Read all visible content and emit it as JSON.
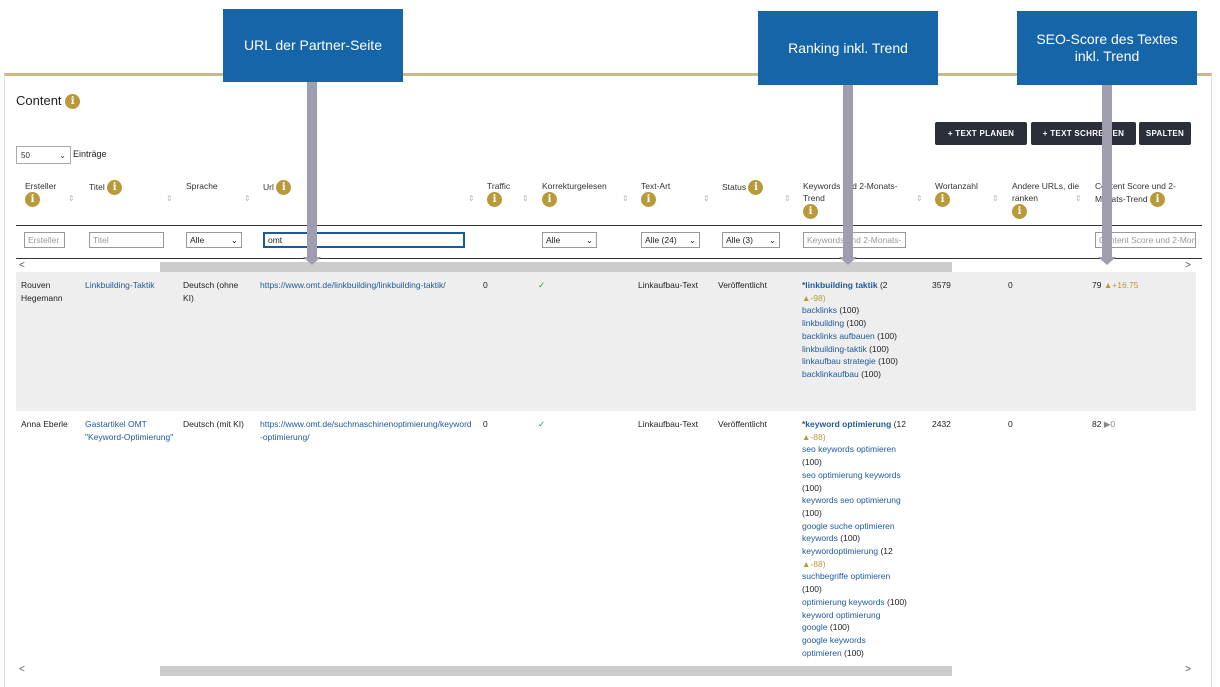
{
  "callouts": {
    "url": "URL der Partner-Seite",
    "ranking": "Ranking inkl. Trend",
    "seo": "SEO-Score des Textes inkl. Trend"
  },
  "content": {
    "title": "Content",
    "info": "i"
  },
  "buttons": {
    "plan": "+ TEXT PLANEN",
    "write": "+ TEXT SCHREIBEN",
    "columns": "SPALTEN"
  },
  "entries": {
    "count": "50",
    "label": "Einträge"
  },
  "headers": {
    "creator": "Ersteller",
    "title": "Titel",
    "language": "Sprache",
    "url": "Url",
    "traffic": "Traffic",
    "proofread": "Korrekturgelesen",
    "type": "Text-Art",
    "status": "Status",
    "keywords": "Keywords und 2-Monats-Trend",
    "words": "Wortanzahl",
    "other": "Andere URLs, die ranken",
    "score": "Content Score und 2-Monats-Trend"
  },
  "filters": {
    "creator": "Ersteller",
    "title": "Titel",
    "language": "Alle",
    "url": "omt",
    "proofread": "Alle",
    "type": "Alle (24)",
    "status": "Alle (3)",
    "keywords": "Keywords und 2-Monats-",
    "score": "Content Score und 2-Mon"
  },
  "rows": [
    {
      "creator": "Rouven Hegemann",
      "title": "Linkbuilding-Taktik",
      "language": "Deutsch (ohne KI)",
      "url": "https://www.omt.de/linkbuilding/linkbuilding-taktik/",
      "traffic": "0",
      "proofread": "✓",
      "type": "Linkaufbau-Text",
      "status": "Veröffentlicht",
      "main_kw": "*linkbuilding taktik",
      "main_rank": "(2",
      "main_trend": "▲-98)",
      "keywords": [
        {
          "k": "backlinks",
          "r": "(100)"
        },
        {
          "k": "linkbuilding",
          "r": "(100)"
        },
        {
          "k": "backlinks aufbauen",
          "r": "(100)"
        },
        {
          "k": "linkbuilding-taktik",
          "r": "(100)"
        },
        {
          "k": "linkaufbau strategie",
          "r": "(100)"
        },
        {
          "k": "backlinkaufbau",
          "r": "(100)"
        }
      ],
      "words": "3579",
      "other": "0",
      "score": "79",
      "score_trend": "▲+16.75"
    },
    {
      "creator": "Anna Eberle",
      "title": "Gastartikel OMT \"Keyword-Optimierung\"",
      "language": "Deutsch (mit KI)",
      "url": "https://www.omt.de/suchmaschinenoptimierung/keyword-optimierung/",
      "traffic": "0",
      "proofread": "✓",
      "type": "Linkaufbau-Text",
      "status": "Veröffentlicht",
      "main_kw": "*keyword optimierung",
      "main_rank": "(12",
      "main_trend": "▲-88)",
      "words": "2432",
      "other": "0",
      "score": "82",
      "score_trend": "▶0"
    }
  ],
  "row2_lines": [
    "seo keywords optimieren",
    "(100)",
    "seo optimierung keywords",
    "(100)",
    "keywords seo optimierung",
    "(100)",
    "google suche optimieren",
    "keywords (100)",
    "keywordoptimierung (12",
    "▲-88)",
    "suchbegriffe optimieren",
    "(100)",
    "optimierung keywords (100)",
    "keyword optimierung",
    "google (100)",
    "google keywords",
    "optimieren (100)"
  ],
  "scroll": {
    "left": "<",
    "right": ">"
  }
}
